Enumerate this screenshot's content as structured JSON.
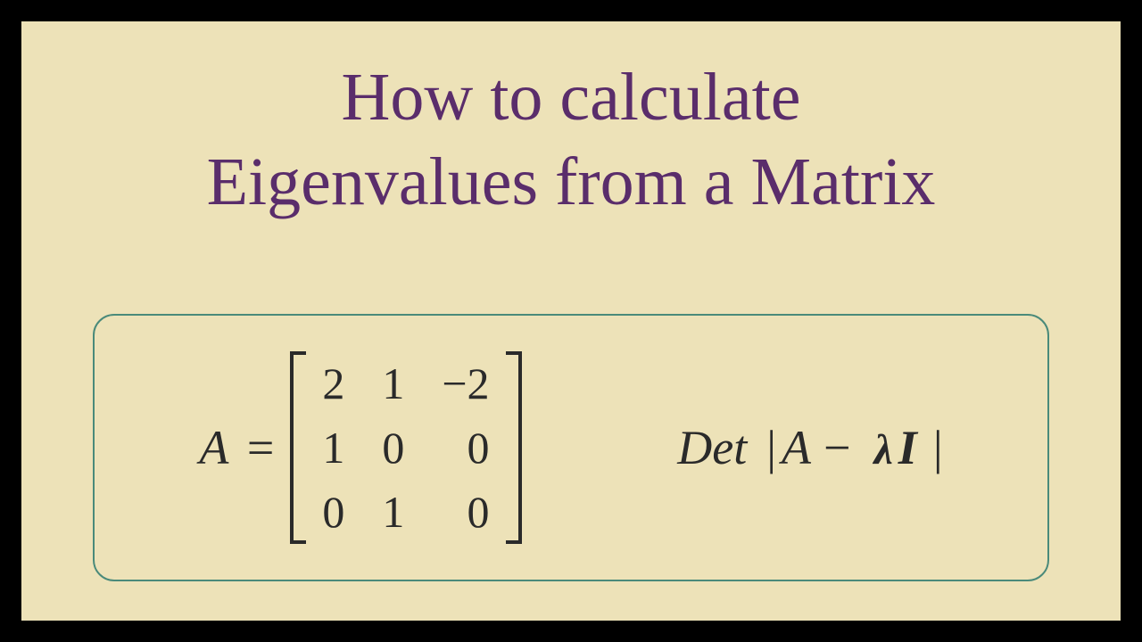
{
  "title_line1": "How to calculate",
  "title_line2": "Eigenvalues from a Matrix",
  "matrix_label": "A",
  "equals": "=",
  "matrix": {
    "r0c0": "2",
    "r0c1": "1",
    "r0c2": "−2",
    "r1c0": "1",
    "r1c1": "0",
    "r1c2": "0",
    "r2c0": "0",
    "r2c1": "1",
    "r2c2": "0"
  },
  "det": {
    "label": "Det",
    "bar_l": "|",
    "A": "A",
    "minus": "−",
    "lambda": "λ",
    "I": "I",
    "bar_r": "|"
  }
}
